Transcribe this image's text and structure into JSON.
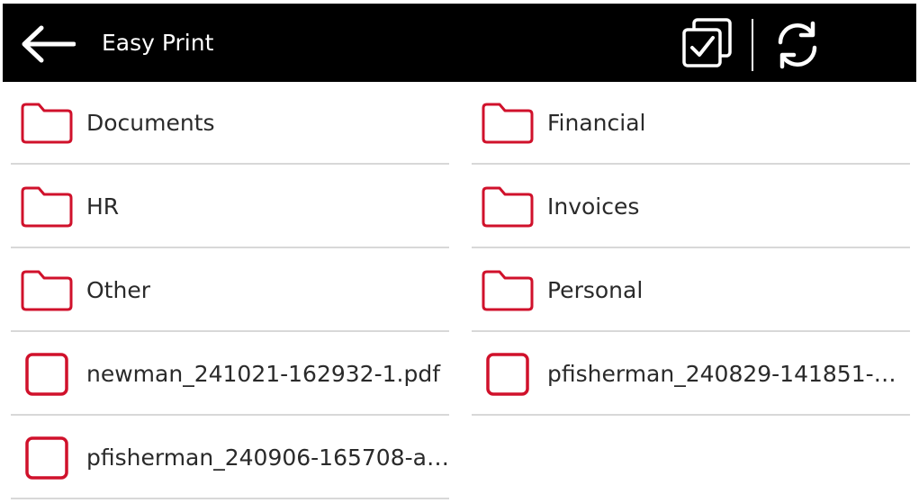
{
  "header": {
    "title": "Easy Print",
    "back_icon": "arrow-left-icon",
    "select_all_icon": "multi-select-check-icon",
    "refresh_icon": "refresh-icon"
  },
  "colors": {
    "header_background": "#000000",
    "header_foreground": "#ffffff",
    "accent": "#d0112b",
    "divider": "#d8d8d8",
    "text": "#2a2a2a"
  },
  "items": [
    {
      "label": "Documents",
      "kind": "folder",
      "icon": "folder-icon"
    },
    {
      "label": "Financial",
      "kind": "folder",
      "icon": "folder-icon"
    },
    {
      "label": "HR",
      "kind": "folder",
      "icon": "folder-icon"
    },
    {
      "label": "Invoices",
      "kind": "folder",
      "icon": "folder-icon"
    },
    {
      "label": "Other",
      "kind": "folder",
      "icon": "folder-icon"
    },
    {
      "label": "Personal",
      "kind": "folder",
      "icon": "folder-icon"
    },
    {
      "label": "newman_241021-162932-1.pdf",
      "kind": "file",
      "icon": "checkbox-unchecked-icon"
    },
    {
      "label": "pfisherman_240829-141851-…",
      "kind": "file",
      "icon": "checkbox-unchecked-icon"
    },
    {
      "label": "pfisherman_240906-165708-a…",
      "kind": "file",
      "icon": "checkbox-unchecked-icon"
    }
  ]
}
